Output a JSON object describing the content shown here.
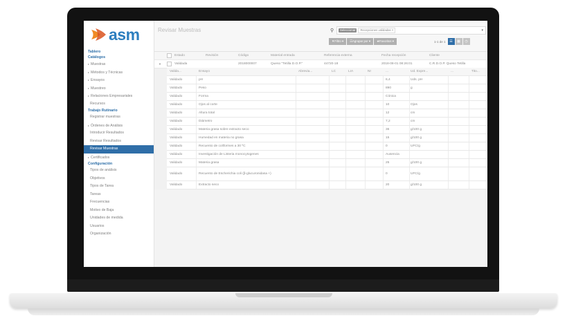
{
  "app": {
    "logo_text": "asm",
    "page_title": "Revisar Muestras",
    "colors": {
      "accent": "#2f6ea8",
      "logo": "#2e7fbf"
    }
  },
  "sidebar": {
    "items": [
      {
        "label": "Tablero",
        "type": "section"
      },
      {
        "label": "Catálogos",
        "type": "section"
      },
      {
        "label": "Muestras",
        "type": "expandable"
      },
      {
        "label": "Métodos y Técnicas",
        "type": "expandable"
      },
      {
        "label": "Ensayos",
        "type": "expandable"
      },
      {
        "label": "Muestreo",
        "type": "expandable"
      },
      {
        "label": "Relaciones Empresariales",
        "type": "expandable"
      },
      {
        "label": "Recursos",
        "type": "child"
      },
      {
        "label": "Trabajo Rutinario",
        "type": "section"
      },
      {
        "label": "Registrar muestras",
        "type": "child"
      },
      {
        "label": "Órdenes de Análisis",
        "type": "expandable"
      },
      {
        "label": "Introducir Resultados",
        "type": "child"
      },
      {
        "label": "Revisar Resultados",
        "type": "child"
      },
      {
        "label": "Revisar Muestras",
        "type": "active"
      },
      {
        "label": "Certificados",
        "type": "expandable"
      },
      {
        "label": "Configuración",
        "type": "section"
      },
      {
        "label": "Tipos de análisis",
        "type": "child"
      },
      {
        "label": "Objetivos",
        "type": "child"
      },
      {
        "label": "Tipos de Tarea",
        "type": "child"
      },
      {
        "label": "Tareas",
        "type": "child"
      },
      {
        "label": "Frecuencias",
        "type": "child"
      },
      {
        "label": "Motivo de Baja",
        "type": "child"
      },
      {
        "label": "Unidades de medida",
        "type": "child"
      },
      {
        "label": "Usuarios",
        "type": "child"
      },
      {
        "label": "Organización",
        "type": "child"
      }
    ]
  },
  "search": {
    "facet_label": "Seleccionar",
    "facet_chip": "Recepciones validadas ×"
  },
  "filters": {
    "filter_label": "▼Filtro ▾",
    "group_label": "☰Agrupar por ▾",
    "favorites_label": "★Favoritos ▾"
  },
  "pager": {
    "text": "1-1 de 1"
  },
  "main_table": {
    "headers": [
      "Estado",
      "Revisión",
      "Código",
      "Material entrada",
      "Referencia externa",
      "Fecha recepción",
      "Cliente"
    ],
    "row": {
      "estado": "Validada",
      "revision": "",
      "codigo": "2018000007",
      "material": "Queso \"Tetilla D.O.P.\"",
      "referencia": "44720-18",
      "fecha": "2018-08-01 08:26:01",
      "cliente": "C.R.D.O.P. Queso Tetilla"
    }
  },
  "sub_table": {
    "headers": [
      "Valida...",
      "Ensayo",
      "Abrevia...",
      "LC",
      "LIA",
      "Nr",
      "...",
      "Ud. Expre...",
      "...",
      "Tito..."
    ],
    "rows": [
      {
        "estado": "Validado",
        "ensayo": "pH",
        "valor": "6,4",
        "unidad": "Uds. pH"
      },
      {
        "estado": "Validado",
        "ensayo": "Peso",
        "valor": "890",
        "unidad": "g"
      },
      {
        "estado": "Validado",
        "ensayo": "Forma",
        "valor": "Cónica",
        "unidad": ""
      },
      {
        "estado": "Validado",
        "ensayo": "Ojos al corte",
        "valor": "10",
        "unidad": "Ojos"
      },
      {
        "estado": "Validado",
        "ensayo": "Altura total",
        "valor": "12",
        "unidad": "cm"
      },
      {
        "estado": "Validado",
        "ensayo": "Diámetro",
        "valor": "7,2",
        "unidad": "cm"
      },
      {
        "estado": "Validado",
        "ensayo": "Materia grasa sobre extracto seco",
        "valor": "36",
        "unidad": "g/100 g"
      },
      {
        "estado": "Validado",
        "ensayo": "Humedad en materia no grasa",
        "valor": "15",
        "unidad": "g/100 g"
      },
      {
        "estado": "Validado",
        "ensayo": "Recuento de coliformes a 30 ºC",
        "valor": "0",
        "unidad": "UFC/g"
      },
      {
        "estado": "Validado",
        "ensayo": "Investigación de Listeria monocytogenes",
        "valor": "Ausencia",
        "unidad": ""
      },
      {
        "estado": "Validado",
        "ensayo": "Materia grasa",
        "valor": "25",
        "unidad": "g/100 g"
      },
      {
        "estado": "Validado",
        "ensayo": "Recuento de Escherichia coli (β-glucuronidasa +)",
        "valor": "0",
        "unidad": "UFC/g",
        "tall": true
      },
      {
        "estado": "Validado",
        "ensayo": "Extracto seco",
        "valor": "20",
        "unidad": "g/100 g"
      }
    ]
  }
}
